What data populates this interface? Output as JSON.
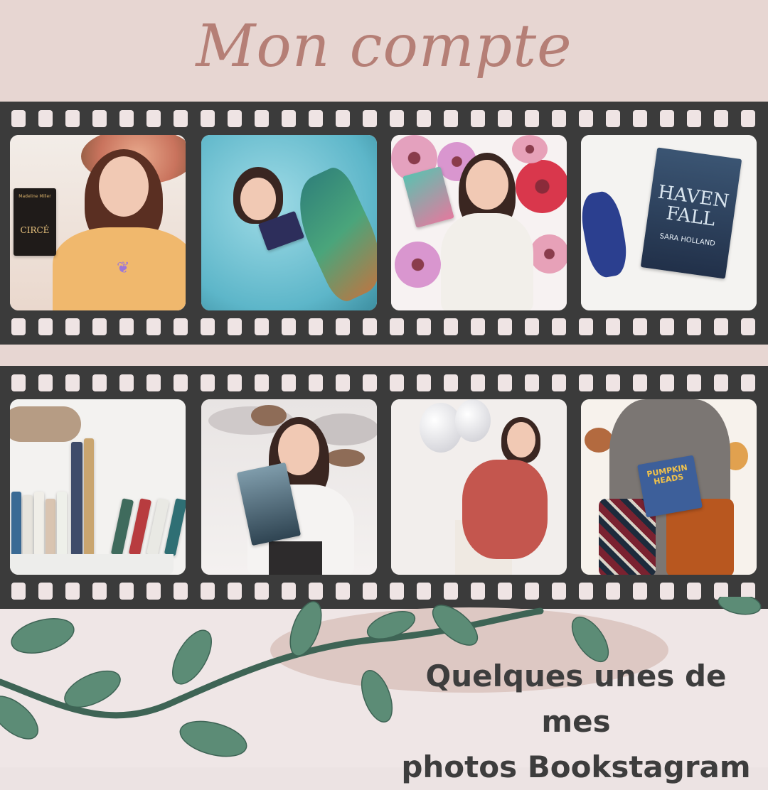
{
  "title": "Mon compte",
  "subtitle_line1": "Quelques unes de mes",
  "subtitle_line2": "photos Bookstagram",
  "colors": {
    "title": "#b57f76",
    "film": "#3b3b3b",
    "background_top": "#e7d6d2",
    "background_bottom": "#efe6e6",
    "leaf": "#5c8c76",
    "vine": "#3e6455",
    "subtitle": "#3d3d3d"
  },
  "photos": {
    "p1": {
      "book_title": "CIRCÉ",
      "book_author": "Madeline Miller"
    },
    "p4": {
      "book_title_1": "HAVEN",
      "book_title_2": "FALL",
      "book_author": "SARA HOLLAND"
    },
    "p8": {
      "book_title": "PUMPKIN HEADS"
    }
  }
}
